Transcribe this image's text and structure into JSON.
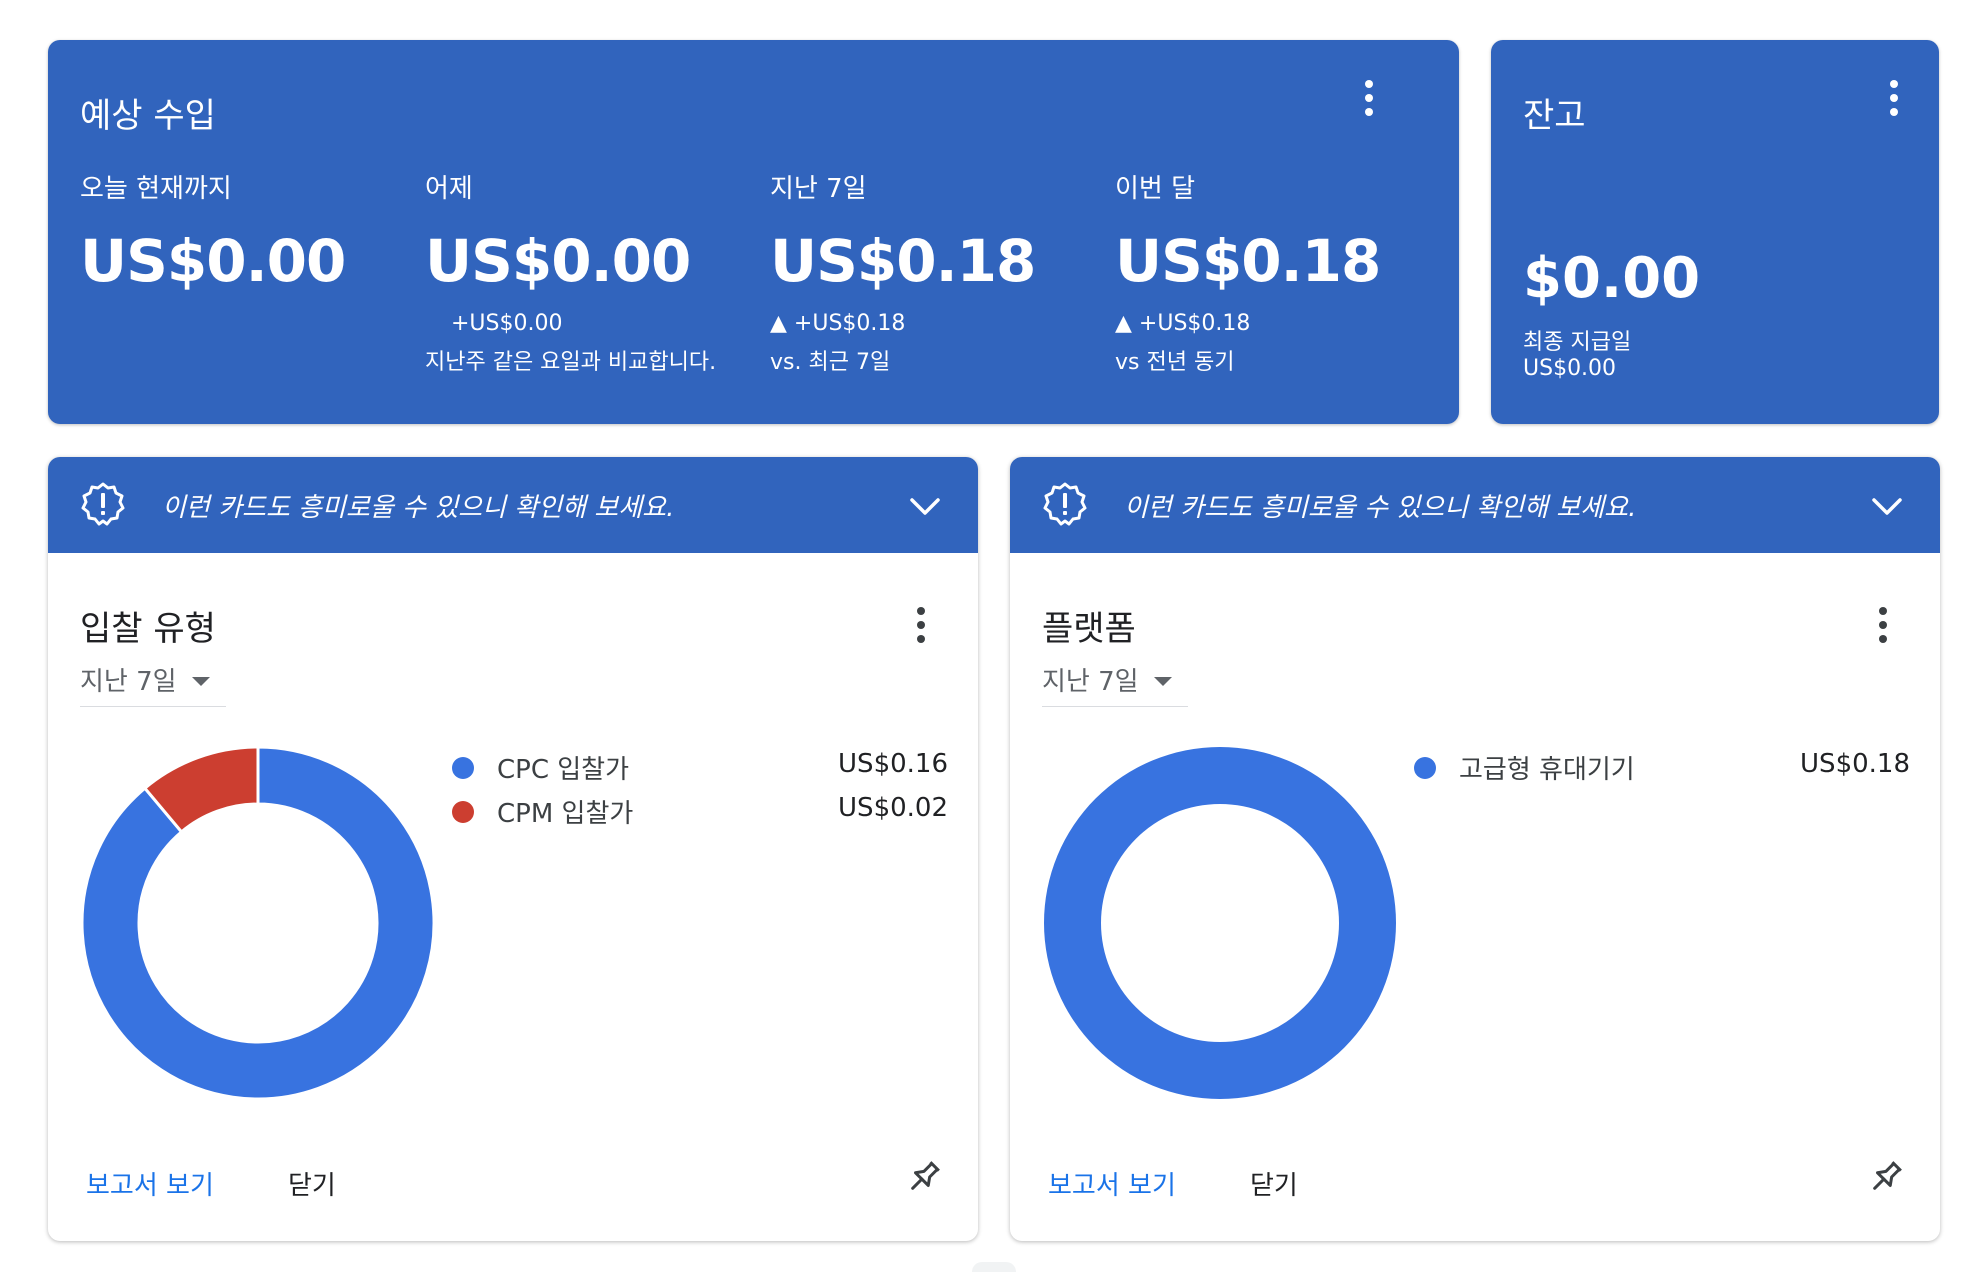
{
  "earnings": {
    "title": "예상 수입",
    "menu_icon": "more-vert-icon",
    "metrics": [
      {
        "label": "오늘 현재까지",
        "value": "US$0.00",
        "compare_1": "",
        "compare_2": ""
      },
      {
        "label": "어제",
        "value": "US$0.00",
        "compare_1": "+US$0.00",
        "compare_2": "지난주 같은 요일과 비교합니다."
      },
      {
        "label": "지난 7일",
        "value": "US$0.18",
        "compare_1": "▲ +US$0.18",
        "compare_2": "vs. 최근 7일"
      },
      {
        "label": "이번 달",
        "value": "US$0.18",
        "compare_1": "▲ +US$0.18",
        "compare_2": "vs 전년 동기"
      }
    ]
  },
  "balance": {
    "title": "잔고",
    "value": "$0.00",
    "last_payment_label": "최종 지급일",
    "last_payment_value": "US$0.00"
  },
  "cards": [
    {
      "banner_text": "이런 카드도 흥미로울 수 있으니 확인해 보세요.",
      "title": "입찰 유형",
      "period": "지난 7일",
      "legend": [
        {
          "name": "CPC 입찰가",
          "value": "US$0.16",
          "color": "#3873e0"
        },
        {
          "name": "CPM 입찰가",
          "value": "US$0.02",
          "color": "#cc3e30"
        }
      ],
      "report_button": "보고서 보기",
      "close_button": "닫기"
    },
    {
      "banner_text": "이런 카드도 흥미로울 수 있으니 확인해 보세요.",
      "title": "플랫폼",
      "period": "지난 7일",
      "legend": [
        {
          "name": "고급형 휴대기기",
          "value": "US$0.18",
          "color": "#3873e0"
        }
      ],
      "report_button": "보고서 보기",
      "close_button": "닫기"
    }
  ],
  "chart_data": [
    {
      "type": "pie",
      "categories": [
        "CPC 입찰가",
        "CPM 입찰가"
      ],
      "values": [
        0.16,
        0.02
      ],
      "colors": [
        "#3873e0",
        "#cc3e30"
      ],
      "donut": true
    },
    {
      "type": "pie",
      "categories": [
        "고급형 휴대기기"
      ],
      "values": [
        0.18
      ],
      "colors": [
        "#3873e0"
      ],
      "donut": true
    }
  ],
  "colors": {
    "card_blue": "#3164bd",
    "link_blue": "#1a73e8",
    "series_blue": "#3873e0",
    "series_red": "#cc3e30"
  }
}
